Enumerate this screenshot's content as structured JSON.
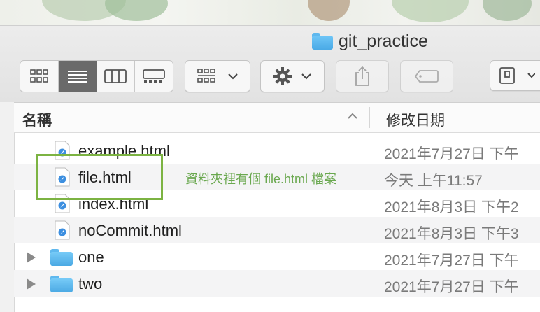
{
  "window": {
    "title": "git_practice"
  },
  "toolbar": {
    "view_buttons": [
      {
        "icon": "icon-view-icon",
        "active": false
      },
      {
        "icon": "list-view-icon",
        "active": true
      },
      {
        "icon": "column-view-icon",
        "active": false
      },
      {
        "icon": "gallery-view-icon",
        "active": false
      }
    ],
    "group_button_icon": "group-by-icon",
    "action_button_icon": "gear-icon",
    "share_button_icon": "share-icon",
    "tag_button_icon": "tag-icon",
    "extra_button_icon": "device-icon"
  },
  "columns": {
    "name": "名稱",
    "date_modified": "修改日期"
  },
  "files": [
    {
      "name": "example.html",
      "date": "2021年7月27日 下午",
      "kind": "html"
    },
    {
      "name": "file.html",
      "date": "今天 上午11:57",
      "kind": "html"
    },
    {
      "name": "index.html",
      "date": "2021年8月3日 下午2",
      "kind": "html"
    },
    {
      "name": "noCommit.html",
      "date": "2021年8月3日 下午3",
      "kind": "html"
    },
    {
      "name": "one",
      "date": "2021年7月27日 下午",
      "kind": "folder"
    },
    {
      "name": "two",
      "date": "2021年7月27日 下午",
      "kind": "folder"
    }
  ],
  "annotation": {
    "text": "資料夾裡有個 file.html 檔案",
    "color": "#6aa84f"
  },
  "colors": {
    "folder": "#5fb8ee",
    "highlight_box": "#7cb342"
  }
}
